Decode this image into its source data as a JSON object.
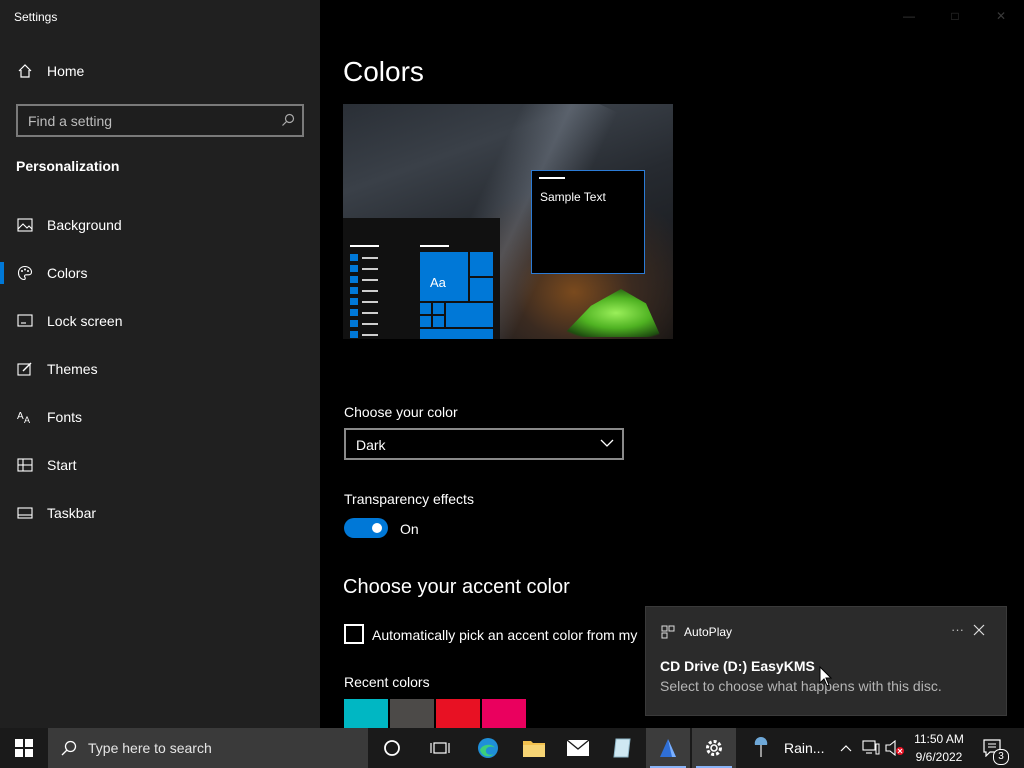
{
  "window": {
    "title": "Settings"
  },
  "sidebar": {
    "home_label": "Home",
    "search_placeholder": "Find a setting",
    "section_title": "Personalization",
    "items": [
      {
        "label": "Background",
        "icon": "picture-icon"
      },
      {
        "label": "Colors",
        "icon": "palette-icon",
        "active": true
      },
      {
        "label": "Lock screen",
        "icon": "lock-screen-icon"
      },
      {
        "label": "Themes",
        "icon": "brush-icon"
      },
      {
        "label": "Fonts",
        "icon": "font-icon"
      },
      {
        "label": "Start",
        "icon": "start-icon"
      },
      {
        "label": "Taskbar",
        "icon": "taskbar-icon"
      }
    ]
  },
  "main": {
    "title": "Colors",
    "preview": {
      "sample_text": "Sample Text",
      "tile_text": "Aa"
    },
    "choose_color_label": "Choose your color",
    "choose_color_value": "Dark",
    "transparency_label": "Transparency effects",
    "transparency_state": "On",
    "accent_heading": "Choose your accent color",
    "auto_accent_label": "Automatically pick an accent color from my",
    "recent_colors_label": "Recent colors",
    "recent_colors": [
      "#00b7c3",
      "#4c4a48",
      "#e81123",
      "#ea005e"
    ]
  },
  "toast": {
    "app": "AutoPlay",
    "title": "CD Drive (D:) EasyKMS",
    "body": "Select to choose what happens with this disc."
  },
  "taskbar": {
    "search_placeholder": "Type here to search",
    "rain_label": "Rain...",
    "time": "11:50 AM",
    "date": "9/6/2022",
    "notification_count": "3"
  },
  "colors": {
    "accent": "#0078d7",
    "sidebar_bg": "#202020",
    "content_bg": "#000000"
  }
}
